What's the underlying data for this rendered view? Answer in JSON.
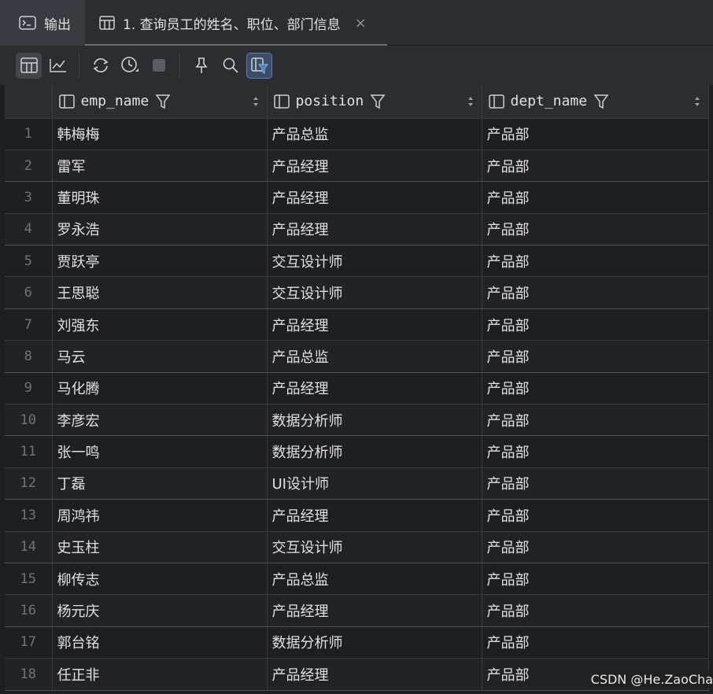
{
  "tabs": [
    {
      "label": "输出",
      "icon": "console-icon"
    },
    {
      "label": "1. 查询员工的姓名、职位、部门信息",
      "icon": "table-icon",
      "close": "×"
    }
  ],
  "toolbar": {
    "items": [
      "table-view-icon",
      "chart-view-icon",
      "refresh-icon",
      "history-icon",
      "stop-icon",
      "pin-icon",
      "search-icon",
      "filter-toggle-icon"
    ]
  },
  "columns": [
    "emp_name",
    "position",
    "dept_name"
  ],
  "rows": [
    {
      "n": "1",
      "emp_name": "韩梅梅",
      "position": "产品总监",
      "dept_name": "产品部"
    },
    {
      "n": "2",
      "emp_name": "雷军",
      "position": "产品经理",
      "dept_name": "产品部"
    },
    {
      "n": "3",
      "emp_name": "董明珠",
      "position": "产品经理",
      "dept_name": "产品部"
    },
    {
      "n": "4",
      "emp_name": "罗永浩",
      "position": "产品经理",
      "dept_name": "产品部"
    },
    {
      "n": "5",
      "emp_name": "贾跃亭",
      "position": "交互设计师",
      "dept_name": "产品部"
    },
    {
      "n": "6",
      "emp_name": "王思聪",
      "position": "交互设计师",
      "dept_name": "产品部"
    },
    {
      "n": "7",
      "emp_name": "刘强东",
      "position": "产品经理",
      "dept_name": "产品部"
    },
    {
      "n": "8",
      "emp_name": "马云",
      "position": "产品总监",
      "dept_name": "产品部"
    },
    {
      "n": "9",
      "emp_name": "马化腾",
      "position": "产品经理",
      "dept_name": "产品部"
    },
    {
      "n": "10",
      "emp_name": "李彦宏",
      "position": "数据分析师",
      "dept_name": "产品部"
    },
    {
      "n": "11",
      "emp_name": "张一鸣",
      "position": "数据分析师",
      "dept_name": "产品部"
    },
    {
      "n": "12",
      "emp_name": "丁磊",
      "position": "UI设计师",
      "dept_name": "产品部"
    },
    {
      "n": "13",
      "emp_name": "周鸿祎",
      "position": "产品经理",
      "dept_name": "产品部"
    },
    {
      "n": "14",
      "emp_name": "史玉柱",
      "position": "交互设计师",
      "dept_name": "产品部"
    },
    {
      "n": "15",
      "emp_name": "柳传志",
      "position": "产品总监",
      "dept_name": "产品部"
    },
    {
      "n": "16",
      "emp_name": "杨元庆",
      "position": "产品经理",
      "dept_name": "产品部"
    },
    {
      "n": "17",
      "emp_name": "郭台铭",
      "position": "数据分析师",
      "dept_name": "产品部"
    },
    {
      "n": "18",
      "emp_name": "任正非",
      "position": "产品经理",
      "dept_name": "产品部"
    }
  ],
  "watermark": "CSDN @He.ZaoCha",
  "colors": {
    "background": "#1e1f22",
    "panel": "#2b2d30",
    "accent": "#4d7cc7"
  }
}
